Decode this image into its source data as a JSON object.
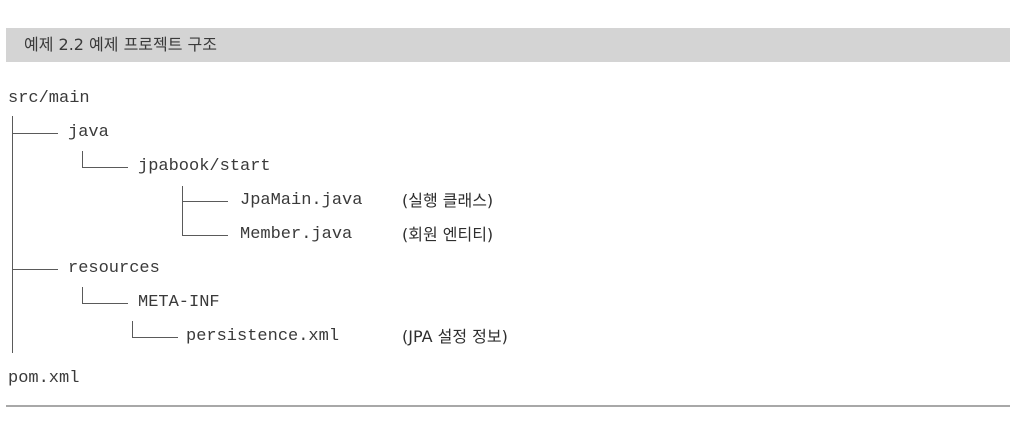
{
  "caption": "예제 2.2 예제 프로젝트 구조",
  "tree": {
    "root": "src/main",
    "java": "java",
    "jpabook_start": "jpabook/start",
    "jpa_main": "JpaMain.java",
    "jpa_main_note": "(실행 클래스)",
    "member": "Member.java",
    "member_note": "(회원 엔티티)",
    "resources": "resources",
    "meta_inf": "META-INF",
    "persistence": "persistence.xml",
    "persistence_note": "(JPA 설정 정보)",
    "pom": "pom.xml"
  }
}
